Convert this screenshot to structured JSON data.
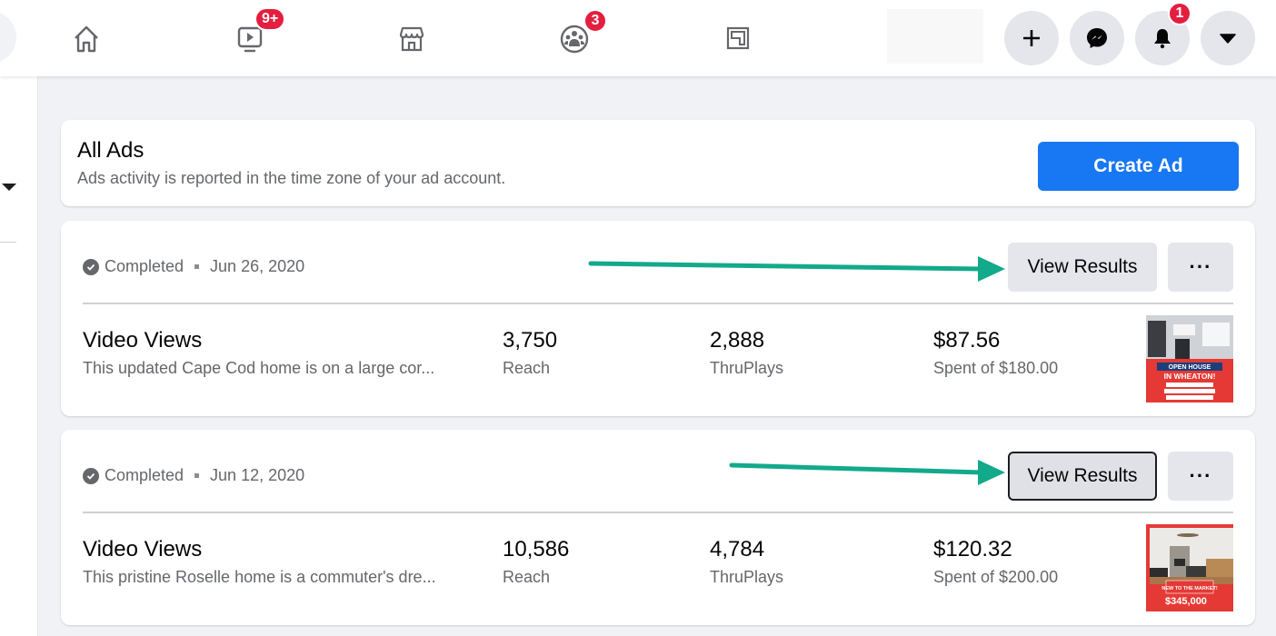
{
  "nav": {
    "tabs": [
      {
        "name": "home",
        "icon": "home-icon"
      },
      {
        "name": "watch",
        "icon": "video-icon",
        "badge": "9+"
      },
      {
        "name": "marketplace",
        "icon": "store-icon"
      },
      {
        "name": "groups",
        "icon": "groups-icon",
        "badge": "3"
      },
      {
        "name": "gaming",
        "icon": "gaming-icon"
      }
    ],
    "actions": [
      {
        "name": "create",
        "icon": "plus-icon"
      },
      {
        "name": "messenger",
        "icon": "messenger-icon"
      },
      {
        "name": "notifications",
        "icon": "bell-icon",
        "badge": "1"
      },
      {
        "name": "account",
        "icon": "caret-down-icon"
      }
    ]
  },
  "header": {
    "title": "All Ads",
    "subtitle": "Ads activity is reported in the time zone of your ad account.",
    "create_label": "Create Ad"
  },
  "ads": [
    {
      "status": "Completed",
      "date": "Jun 26, 2020",
      "view_label": "View Results",
      "more_label": "···",
      "objective": "Video Views",
      "description": "This updated Cape Cod home is on a large cor...",
      "reach_value": "3,750",
      "reach_label": "Reach",
      "thruplays_value": "2,888",
      "thruplays_label": "ThruPlays",
      "spent_value": "$87.56",
      "spent_label": "Spent of $180.00",
      "thumb_line1": "OPEN HOUSE",
      "thumb_line2": "IN WHEATON!"
    },
    {
      "status": "Completed",
      "date": "Jun 12, 2020",
      "view_label": "View Results",
      "more_label": "···",
      "objective": "Video Views",
      "description": "This pristine Roselle home is a commuter's dre...",
      "reach_value": "10,586",
      "reach_label": "Reach",
      "thruplays_value": "4,784",
      "thruplays_label": "ThruPlays",
      "spent_value": "$120.32",
      "spent_label": "Spent of $200.00",
      "thumb_line1": "NEW TO THE MARKET!",
      "thumb_line2": "$345,000"
    }
  ],
  "colors": {
    "brand": "#1877f2",
    "badge": "#e41e3f",
    "annotation_arrow": "#13a98b"
  }
}
